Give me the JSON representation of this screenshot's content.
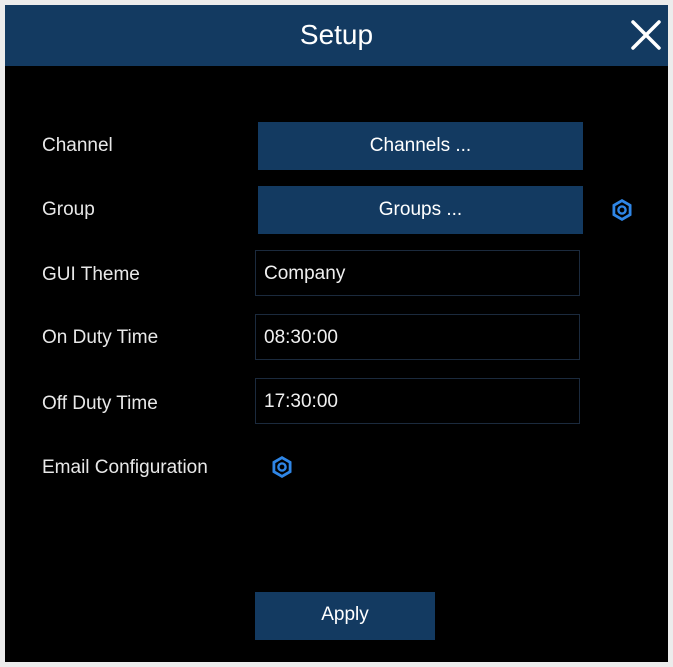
{
  "window": {
    "title": "Setup"
  },
  "icons": {
    "close": "close-icon",
    "settings": "gear-icon"
  },
  "colors": {
    "titlebar": "#133a61",
    "button": "#133a61",
    "accent_icon": "#2f86e6",
    "background": "#000000"
  },
  "form": {
    "channel": {
      "label": "Channel",
      "button_label": "Channels ..."
    },
    "group": {
      "label": "Group",
      "button_label": "Groups ..."
    },
    "gui_theme": {
      "label": "GUI Theme",
      "value": "Company"
    },
    "on_duty_time": {
      "label": "On Duty Time",
      "value": "08:30:00"
    },
    "off_duty_time": {
      "label": "Off Duty Time",
      "value": "17:30:00"
    },
    "email_configuration": {
      "label": "Email Configuration"
    }
  },
  "footer": {
    "apply_label": "Apply"
  }
}
